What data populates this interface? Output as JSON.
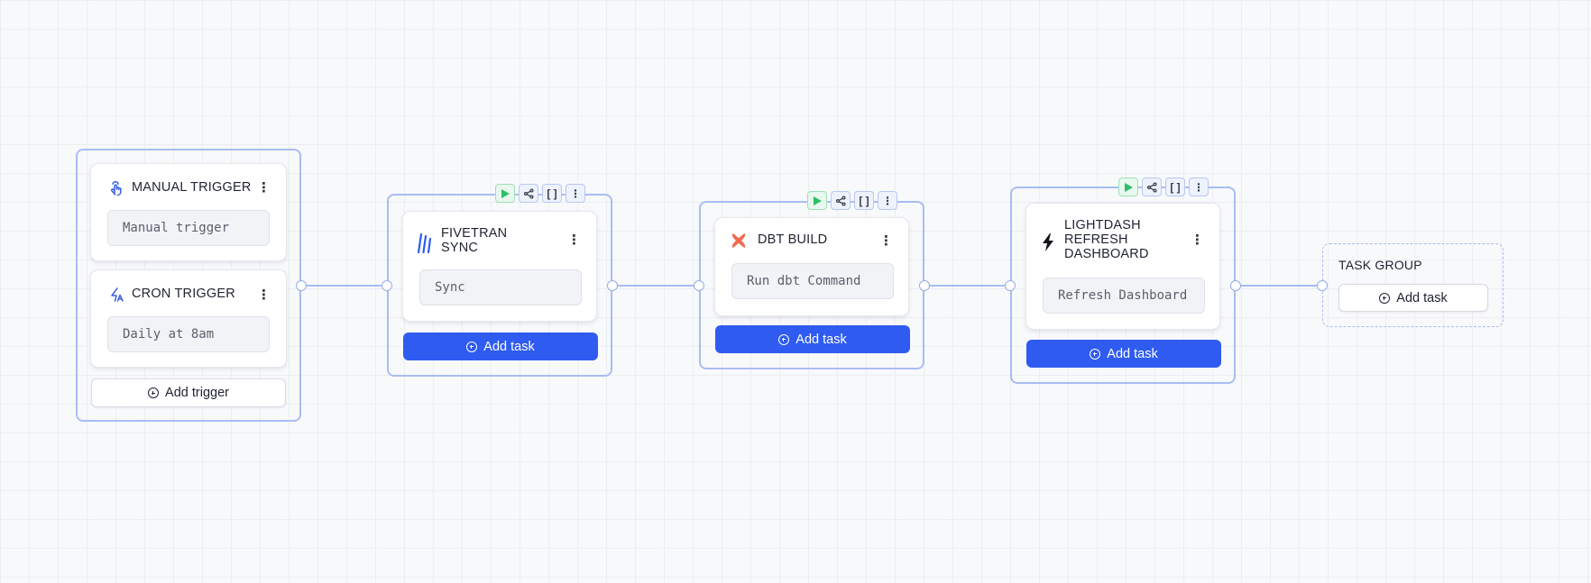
{
  "trigger_group": {
    "triggers": [
      {
        "title": "MANUAL TRIGGER",
        "value": "Manual trigger",
        "icon": "hand-pointer-icon"
      },
      {
        "title": "CRON TRIGGER",
        "value": "Daily at 8am",
        "icon": "cron-icon"
      }
    ],
    "add_trigger_label": "Add trigger"
  },
  "tasks": [
    {
      "title_lines": [
        "FIVETRAN",
        "SYNC"
      ],
      "value": "Sync",
      "icon": "fivetran-icon",
      "add_task_label": "Add task"
    },
    {
      "title_lines": [
        "DBT BUILD"
      ],
      "value": "Run dbt Command",
      "icon": "dbt-icon",
      "add_task_label": "Add task"
    },
    {
      "title_lines": [
        "LIGHTDASH",
        "REFRESH",
        "DASHBOARD"
      ],
      "value": "Refresh Dashboard",
      "icon": "lightning-icon",
      "add_task_label": "Add task"
    }
  ],
  "toolbar": {
    "run": "run-icon",
    "share": "share-icon",
    "brackets_label": "[ ]",
    "more": "more-icon"
  },
  "task_group": {
    "label": "TASK GROUP",
    "add_task_label": "Add task"
  },
  "colors": {
    "accent": "#2f5bf0",
    "group_border": "#a9bdf3",
    "run_green": "#2fbf68",
    "dbt_orange": "#f26b4f"
  }
}
